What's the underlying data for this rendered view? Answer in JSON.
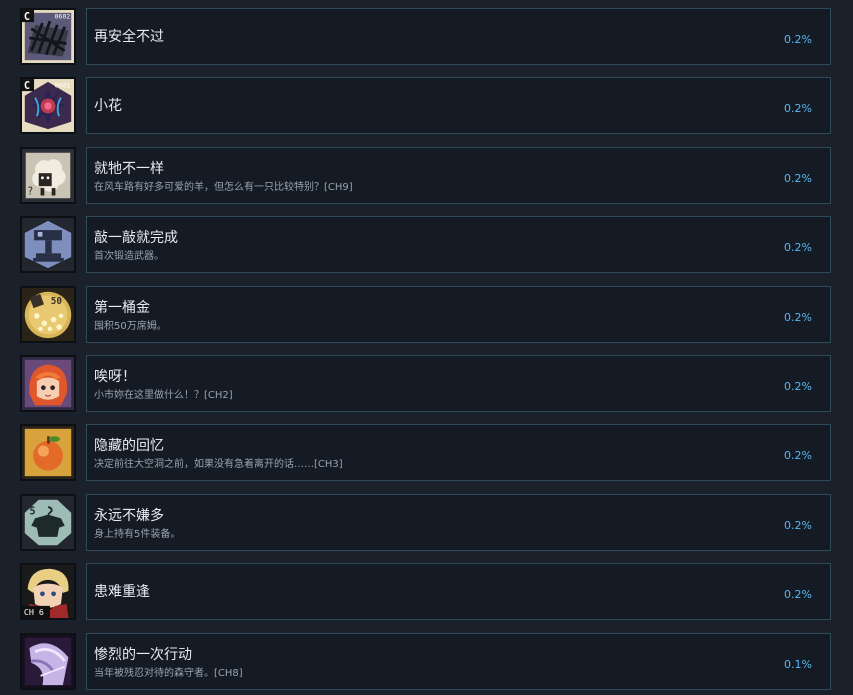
{
  "achievements": [
    {
      "title": "再安全不过",
      "desc": "",
      "percent": "0.2%",
      "icon": "metal-spikes-icon",
      "badge": "C",
      "code": "0602"
    },
    {
      "title": "小花",
      "desc": "",
      "percent": "0.2%",
      "icon": "dark-flower-icon",
      "badge": "C",
      "code": "0601"
    },
    {
      "title": "就牠不一样",
      "desc": "在风车路有好多可爱的羊，但怎么有一只比较特别？[CH9]",
      "percent": "0.2%",
      "icon": "sheep-icon"
    },
    {
      "title": "敲一敲就完成",
      "desc": "首次锻造武器。",
      "percent": "0.2%",
      "icon": "hammer-anvil-icon"
    },
    {
      "title": "第一桶金",
      "desc": "囤积50万席姆。",
      "percent": "0.2%",
      "icon": "gold-coins-icon",
      "badge": "50"
    },
    {
      "title": "唉呀！",
      "desc": "小市妳在这里做什么！？[CH2]",
      "percent": "0.2%",
      "icon": "red-hair-girl-icon"
    },
    {
      "title": "隐藏的回忆",
      "desc": "决定前往大空洞之前，如果没有急着离开的话……[CH3]",
      "percent": "0.2%",
      "icon": "apple-icon"
    },
    {
      "title": "永远不嫌多",
      "desc": "身上持有5件装备。",
      "percent": "0.2%",
      "icon": "shirt-hanger-icon",
      "badge": "5"
    },
    {
      "title": "患难重逢",
      "desc": "",
      "percent": "0.2%",
      "icon": "blonde-boy-icon",
      "badge": "CH 6"
    },
    {
      "title": "惨烈的一次行动",
      "desc": "当年被残忍对待的森守者。[CH8]",
      "percent": "0.1%",
      "icon": "purple-hair-figure-icon"
    }
  ]
}
